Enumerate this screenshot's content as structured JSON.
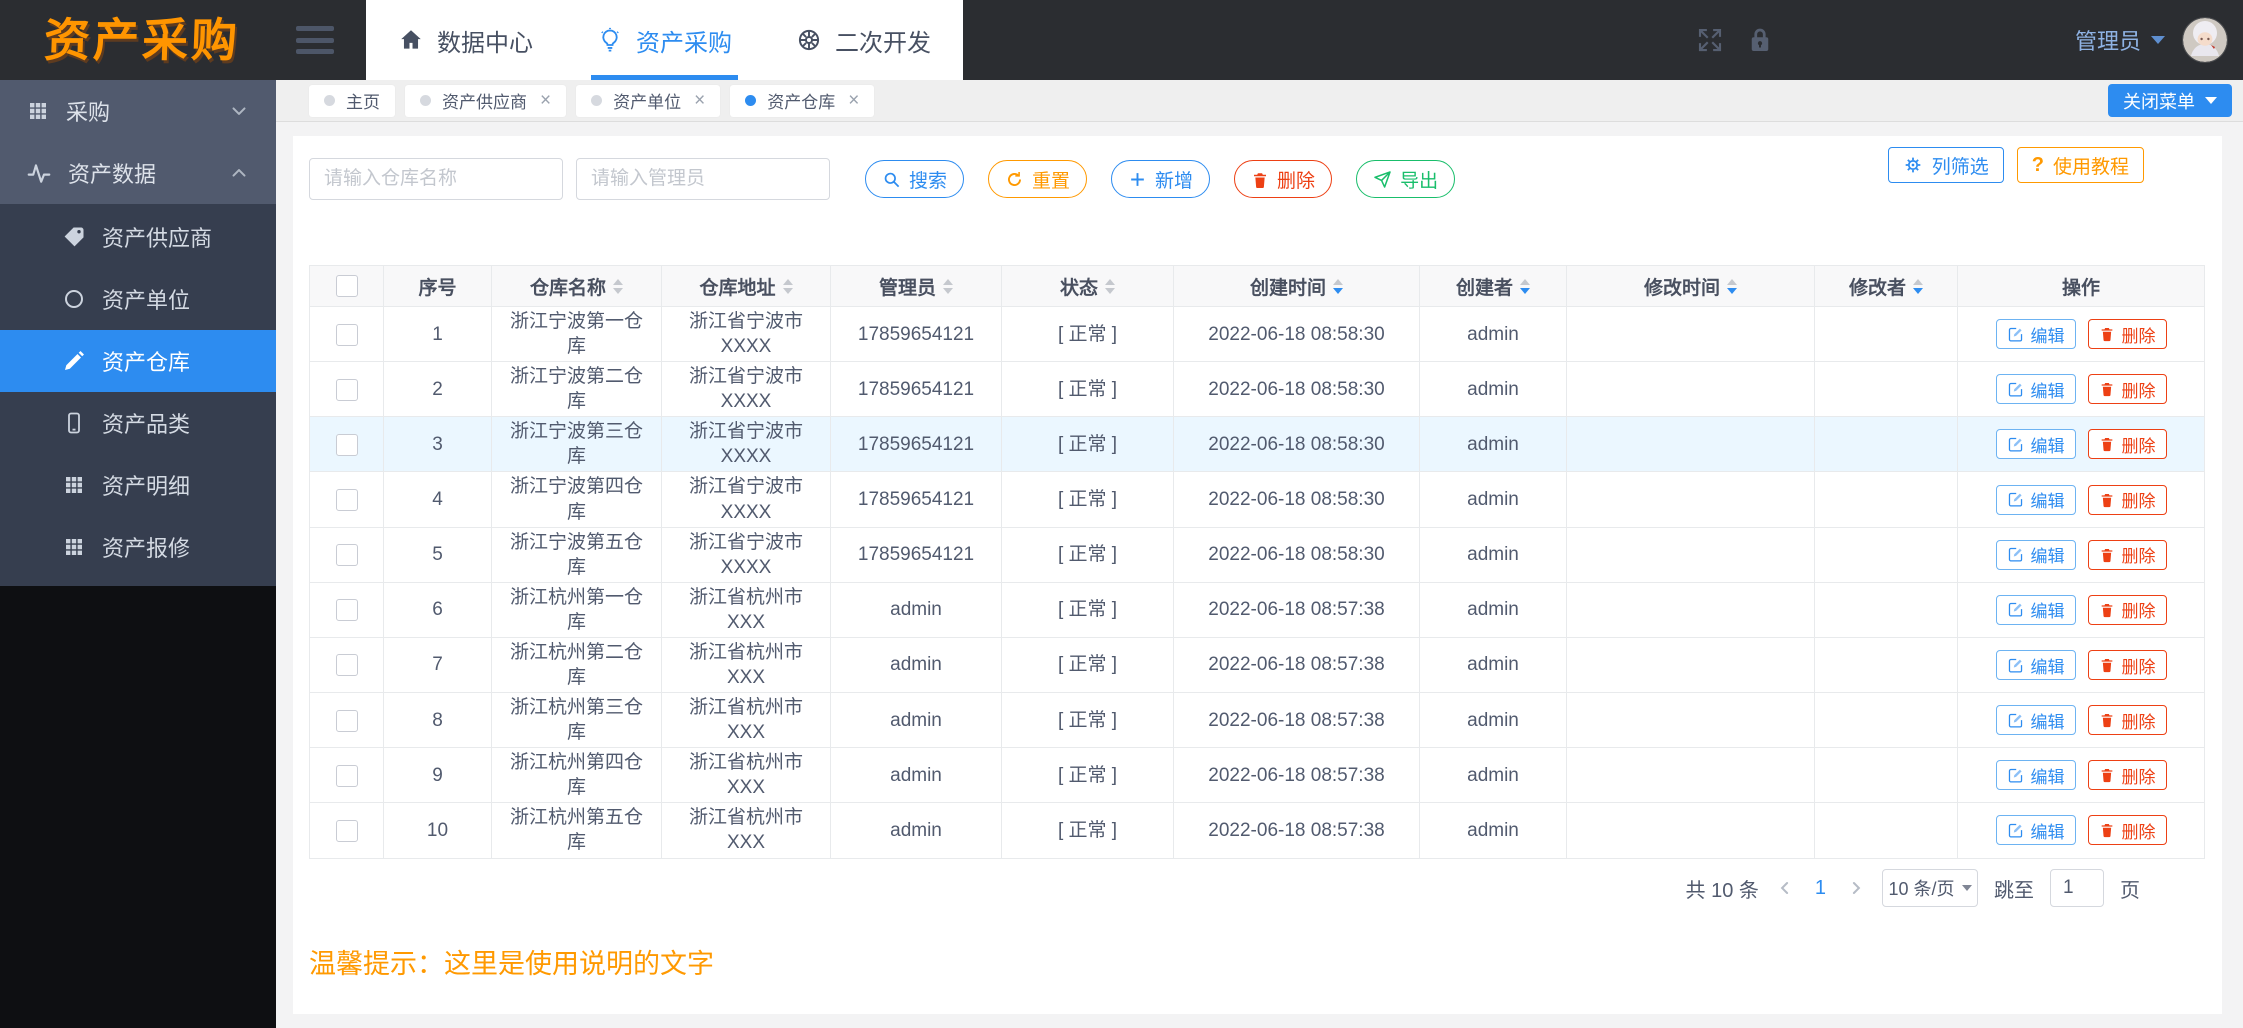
{
  "header": {
    "logo": "资产采购",
    "nav": [
      {
        "name": "data-center",
        "label": "数据中心",
        "icon": "home-icon",
        "active": false
      },
      {
        "name": "asset-purchase",
        "label": "资产采购",
        "icon": "bulb-icon",
        "active": true
      },
      {
        "name": "second-dev",
        "label": "二次开发",
        "icon": "wheel-icon",
        "active": false
      }
    ],
    "user": {
      "name": "管理员"
    }
  },
  "tabs": [
    {
      "name": "home",
      "label": "主页",
      "closable": false,
      "active": false
    },
    {
      "name": "asset-supplier",
      "label": "资产供应商",
      "closable": true,
      "active": false
    },
    {
      "name": "asset-unit",
      "label": "资产单位",
      "closable": true,
      "active": false
    },
    {
      "name": "asset-warehouse",
      "label": "资产仓库",
      "closable": true,
      "active": true
    }
  ],
  "close_menu_button": "关闭菜单",
  "sidebar": {
    "items": [
      {
        "name": "purchase",
        "label": "采购",
        "icon": "grid-icon",
        "expanded": false,
        "children": []
      },
      {
        "name": "asset-data",
        "label": "资产数据",
        "icon": "pulse-icon",
        "expanded": true,
        "children": [
          {
            "name": "asset-supplier",
            "label": "资产供应商",
            "icon": "tag-icon",
            "active": false
          },
          {
            "name": "asset-unit",
            "label": "资产单位",
            "icon": "circle-icon",
            "active": false
          },
          {
            "name": "asset-warehouse",
            "label": "资产仓库",
            "icon": "pencil-icon",
            "active": true
          },
          {
            "name": "asset-category",
            "label": "资产品类",
            "icon": "phone-icon",
            "active": false
          },
          {
            "name": "asset-detail",
            "label": "资产明细",
            "icon": "grid-icon",
            "active": false
          },
          {
            "name": "asset-repair",
            "label": "资产报修",
            "icon": "grid-icon",
            "active": false
          }
        ]
      }
    ]
  },
  "toolbar": {
    "warehouse_placeholder": "请输入仓库名称",
    "manager_placeholder": "请输入管理员",
    "search": "搜索",
    "reset": "重置",
    "add": "新增",
    "delete": "删除",
    "export": "导出",
    "column_filter": "列筛选",
    "tutorial": "使用教程",
    "tutorial_mark": "?"
  },
  "table": {
    "columns": [
      {
        "label": "序号",
        "sort": "none"
      },
      {
        "label": "仓库名称",
        "sort": "both"
      },
      {
        "label": "仓库地址",
        "sort": "both"
      },
      {
        "label": "管理员",
        "sort": "both"
      },
      {
        "label": "状态",
        "sort": "both"
      },
      {
        "label": "创建时间",
        "sort": "desc"
      },
      {
        "label": "创建者",
        "sort": "desc"
      },
      {
        "label": "修改时间",
        "sort": "desc"
      },
      {
        "label": "修改者",
        "sort": "desc"
      },
      {
        "label": "操作",
        "sort": "none"
      }
    ],
    "edit_label": "编辑",
    "delete_label": "删除",
    "highlighted_row": 3,
    "rows": [
      {
        "num": "1",
        "name": "浙江宁波第一仓库",
        "addr": "浙江省宁波市XXXX",
        "manager": "17859654121",
        "status": "[ 正常 ]",
        "created": "2022-06-18 08:58:30",
        "creator": "admin",
        "modified": "",
        "modifier": ""
      },
      {
        "num": "2",
        "name": "浙江宁波第二仓库",
        "addr": "浙江省宁波市XXXX",
        "manager": "17859654121",
        "status": "[ 正常 ]",
        "created": "2022-06-18 08:58:30",
        "creator": "admin",
        "modified": "",
        "modifier": ""
      },
      {
        "num": "3",
        "name": "浙江宁波第三仓库",
        "addr": "浙江省宁波市XXXX",
        "manager": "17859654121",
        "status": "[ 正常 ]",
        "created": "2022-06-18 08:58:30",
        "creator": "admin",
        "modified": "",
        "modifier": ""
      },
      {
        "num": "4",
        "name": "浙江宁波第四仓库",
        "addr": "浙江省宁波市XXXX",
        "manager": "17859654121",
        "status": "[ 正常 ]",
        "created": "2022-06-18 08:58:30",
        "creator": "admin",
        "modified": "",
        "modifier": ""
      },
      {
        "num": "5",
        "name": "浙江宁波第五仓库",
        "addr": "浙江省宁波市XXXX",
        "manager": "17859654121",
        "status": "[ 正常 ]",
        "created": "2022-06-18 08:58:30",
        "creator": "admin",
        "modified": "",
        "modifier": ""
      },
      {
        "num": "6",
        "name": "浙江杭州第一仓库",
        "addr": "浙江省杭州市XXX",
        "manager": "admin",
        "status": "[ 正常 ]",
        "created": "2022-06-18 08:57:38",
        "creator": "admin",
        "modified": "",
        "modifier": ""
      },
      {
        "num": "7",
        "name": "浙江杭州第二仓库",
        "addr": "浙江省杭州市XXX",
        "manager": "admin",
        "status": "[ 正常 ]",
        "created": "2022-06-18 08:57:38",
        "creator": "admin",
        "modified": "",
        "modifier": ""
      },
      {
        "num": "8",
        "name": "浙江杭州第三仓库",
        "addr": "浙江省杭州市XXX",
        "manager": "admin",
        "status": "[ 正常 ]",
        "created": "2022-06-18 08:57:38",
        "creator": "admin",
        "modified": "",
        "modifier": ""
      },
      {
        "num": "9",
        "name": "浙江杭州第四仓库",
        "addr": "浙江省杭州市XXX",
        "manager": "admin",
        "status": "[ 正常 ]",
        "created": "2022-06-18 08:57:38",
        "creator": "admin",
        "modified": "",
        "modifier": ""
      },
      {
        "num": "10",
        "name": "浙江杭州第五仓库",
        "addr": "浙江省杭州市XXX",
        "manager": "admin",
        "status": "[ 正常 ]",
        "created": "2022-06-18 08:57:38",
        "creator": "admin",
        "modified": "",
        "modifier": ""
      }
    ]
  },
  "pagination": {
    "total": "共 10 条",
    "page": "1",
    "page_size": "10 条/页",
    "jump_label": "跳至",
    "jump_value": "1",
    "page_label": "页"
  },
  "hint": "温馨提示：这里是使用说明的文字",
  "colors": {
    "accent": "#2d8cf0",
    "orange": "#ff9900",
    "green": "#19be6b",
    "red": "#ed4014",
    "sidebar": "#515a6e",
    "submenu": "#363e4f",
    "header_dark": "#2b2d31",
    "logo_orange": "#ff9500"
  }
}
